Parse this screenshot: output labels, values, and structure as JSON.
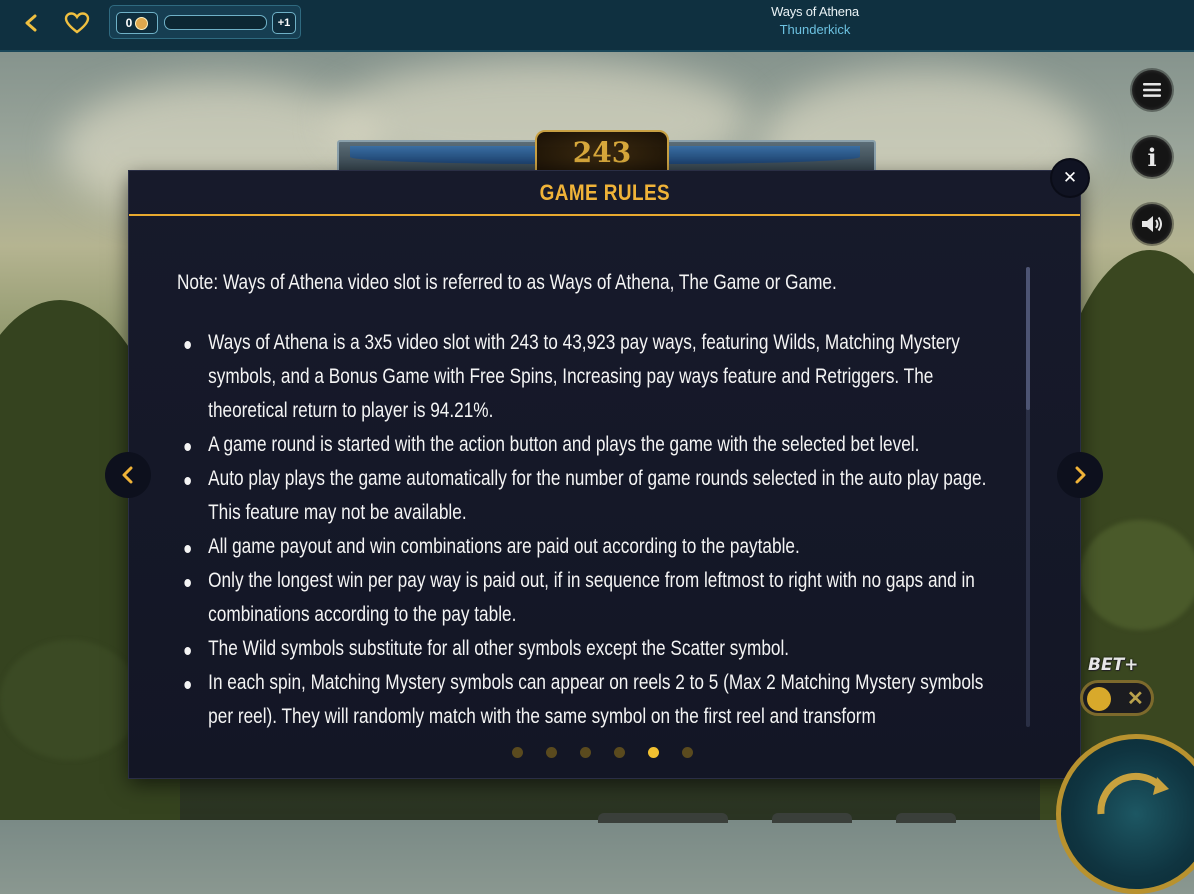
{
  "topbar": {
    "back_icon": "chevron-left-icon",
    "favorite_icon": "heart-icon",
    "coin_count": "0",
    "progress": 0,
    "level_bonus": "+1",
    "game_title": "Ways of Athena",
    "provider": "Thunderkick"
  },
  "side_buttons": {
    "menu_icon": "hamburger-menu-icon",
    "info_label": "i",
    "sound_icon": "speaker-icon"
  },
  "ways_banner": {
    "count": "243"
  },
  "modal": {
    "title": "GAME RULES",
    "close_symbol": "✕",
    "note": "Note: Ways of Athena video slot is referred to as Ways of Athena, The Game or Game.",
    "rules": [
      "Ways of Athena is a 3x5 video slot with 243 to 43,923 pay ways, featuring Wilds, Matching Mystery symbols, and a Bonus Game with Free Spins, Increasing pay ways feature and Retriggers. The theoretical return to player is 94.21%.",
      "A game round is started with the action button and plays the game with the selected bet level.",
      "Auto play plays the game automatically for the number of game rounds selected in the auto play page. This feature may not be available.",
      "All game payout and win combinations are paid out according to the paytable.",
      "Only the longest win per pay way is paid out, if in sequence from leftmost to right with no gaps and in combinations according to the pay table.",
      "The Wild symbols substitute for all other symbols except the Scatter symbol.",
      "In each spin, Matching Mystery symbols can appear on reels 2 to 5 (Max 2 Matching Mystery symbols per reel). They will randomly match with the same symbol on the first reel and transform"
    ],
    "pages": {
      "total": 6,
      "current": 5
    },
    "prev_icon": "chevron-left-icon",
    "next_icon": "chevron-right-icon"
  },
  "bet_plus": {
    "label": "BET+",
    "enabled": false,
    "off_symbol": "✕"
  },
  "colors": {
    "accent": "#f0b338",
    "modal_bg": "#151827",
    "topbar_bg": "#0f3040",
    "provider": "#6cc1e0"
  }
}
